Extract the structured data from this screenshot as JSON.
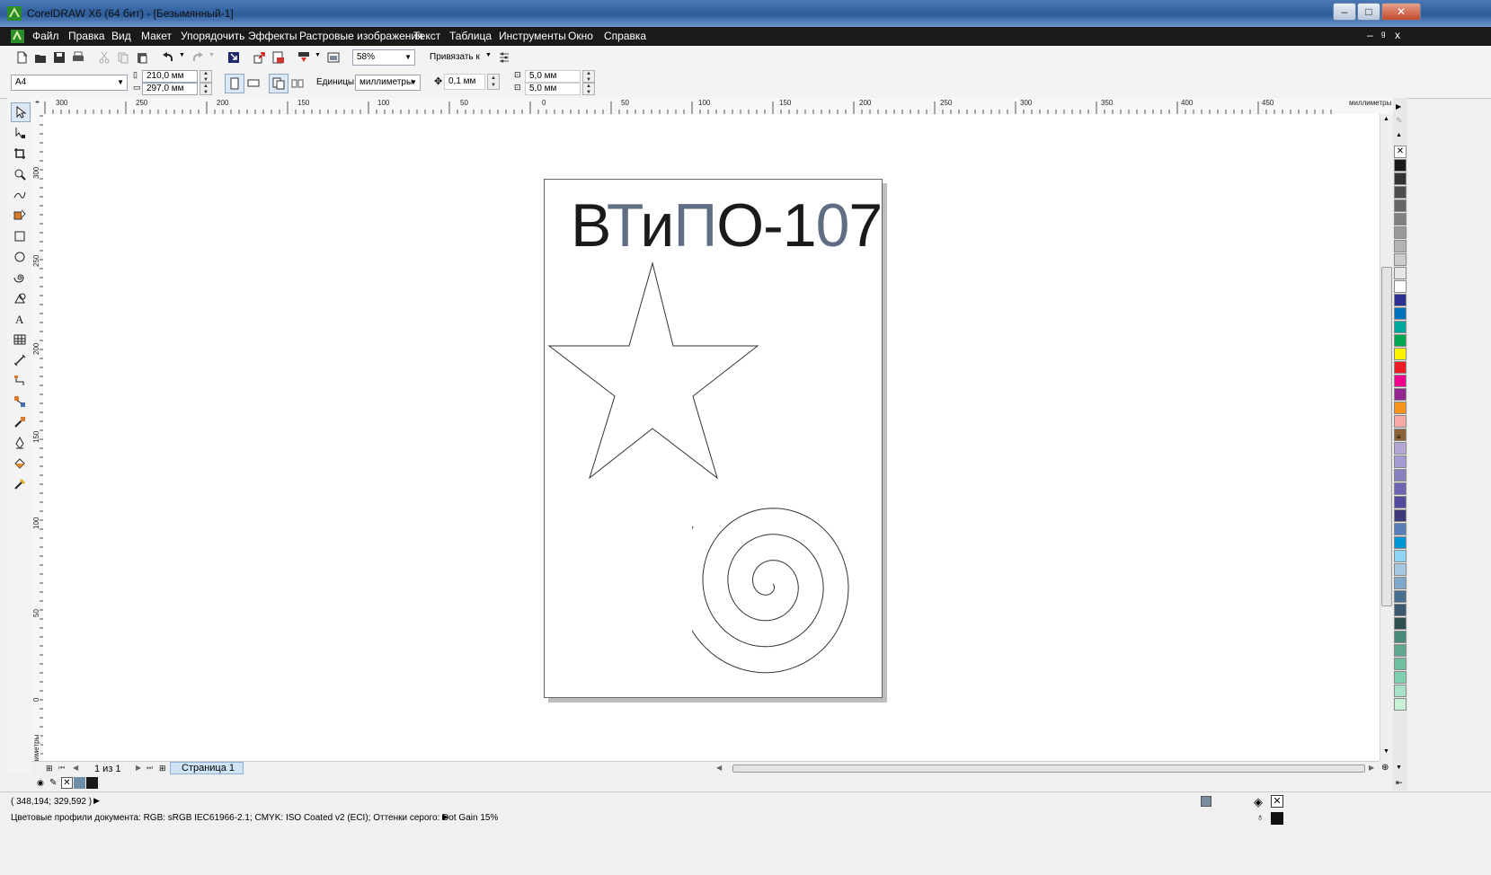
{
  "window": {
    "title": "CorelDRAW X6 (64 бит) - [Безымянный-1]",
    "minimize_glyph": "‒",
    "maximize_glyph": "□",
    "close_glyph": "✕"
  },
  "menubar": {
    "items": [
      "Файл",
      "Правка",
      "Вид",
      "Макет",
      "Упорядочить",
      "Эффекты",
      "Растровые изображения",
      "Текст",
      "Таблица",
      "Инструменты",
      "Окно",
      "Справка"
    ],
    "mdi_minimize": "–",
    "mdi_restore": "ᵍ",
    "mdi_close": "x"
  },
  "toolbar": {
    "zoom_value": "58%",
    "snap_label": "Привязать к"
  },
  "property_bar": {
    "paper_size": "A4",
    "width": "210,0 мм",
    "height": "297,0 мм",
    "units_label": "Единицы:",
    "units_value": "миллиметры",
    "nudge": "0,1 мм",
    "dup_x": "5,0 мм",
    "dup_y": "5,0 мм"
  },
  "rulers": {
    "unit_label": "миллиметры",
    "horizontal_ticks": [
      "300",
      "250",
      "200",
      "150",
      "100",
      "50",
      "0",
      "50",
      "100",
      "150",
      "200",
      "250",
      "300",
      "350",
      "400",
      "450"
    ],
    "vertical_ticks": [
      "300",
      "250",
      "200",
      "150",
      "100",
      "50",
      "0"
    ],
    "vertical_unit_label": "миллиметры"
  },
  "document": {
    "headline_parts": [
      "В",
      "Т",
      "и",
      "П",
      "О-1",
      "0",
      "7"
    ],
    "headline_colors": [
      "#1a1a1a",
      "#5f6e84",
      "#1a1a1a",
      "#5f6e84",
      "#1a1a1a",
      "#5f6e84",
      "#1a1a1a"
    ]
  },
  "page_nav": {
    "counter": "1 из 1",
    "tab": "Страница 1"
  },
  "palette": {
    "colors": [
      "#1a1a1a",
      "#333333",
      "#4d4d4d",
      "#666666",
      "#808080",
      "#999999",
      "#b3b3b3",
      "#cccccc",
      "#e6e6e6",
      "#ffffff",
      "#2e3192",
      "#0071bc",
      "#00a99d",
      "#00a651",
      "#fff200",
      "#ed1c24",
      "#ec008c",
      "#92278f",
      "#f7941d",
      "#f9a8a8",
      "#8c6239",
      "#b4a7d6",
      "#a39bd4",
      "#8781bd",
      "#6c64b0",
      "#514a9d",
      "#3e3a7a",
      "#5a7fb8",
      "#0096d6",
      "#8fd3f5",
      "#a6c8e0",
      "#7fa7c9",
      "#4a6f8f",
      "#3b5a70",
      "#2f4f4f",
      "#4a8a7a",
      "#5fa88f",
      "#6fbf9f",
      "#80d0b0",
      "#a8e0c8",
      "#c8f0d8"
    ]
  },
  "status": {
    "coordinates": "( 348,194; 329,592 )",
    "color_profiles": "Цветовые профили документа: RGB: sRGB IEC61966-2.1; CMYK: ISO Coated v2 (ECI); Оттенки серого: Dot Gain 15%"
  }
}
